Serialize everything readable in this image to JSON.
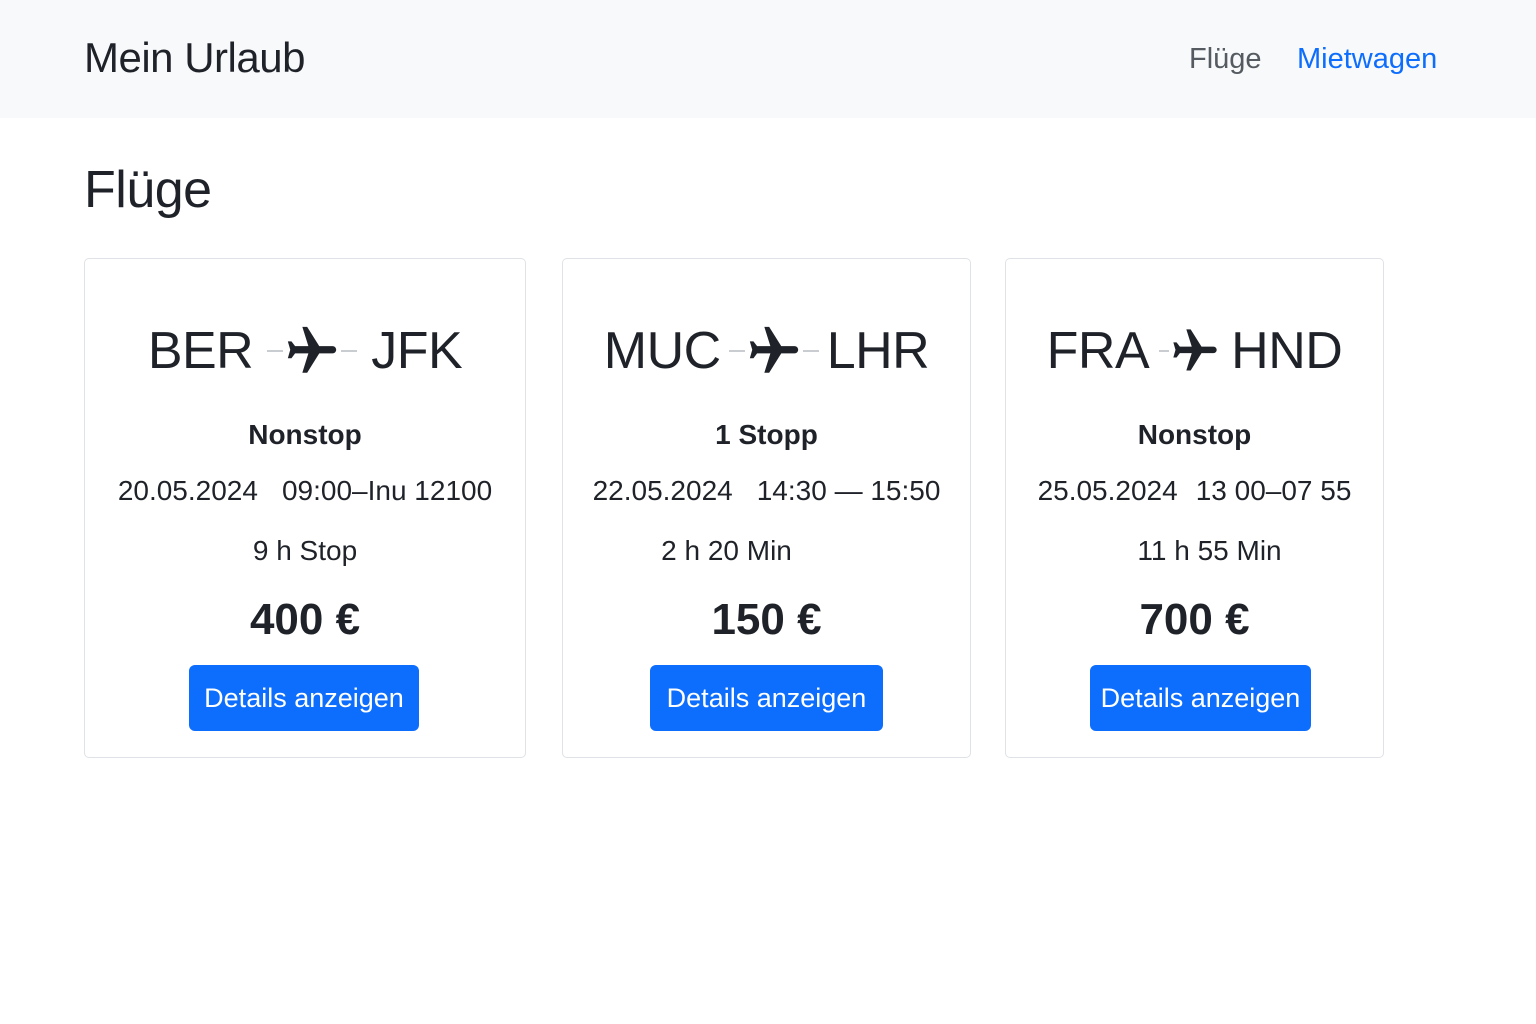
{
  "navbar": {
    "brand": "Mein Urlaub",
    "links": [
      {
        "label": "Flüge",
        "active": false
      },
      {
        "label": "Mietwagen",
        "active": true
      }
    ]
  },
  "page": {
    "title": "Flüge"
  },
  "flights": [
    {
      "from": "BER",
      "to": "JFK",
      "stops": "Nonstop",
      "date": "20.05.2024",
      "time": "09:00–Inu 12100",
      "duration": "9 h Stop",
      "price": "400 €",
      "button_label": "Details anzeigen"
    },
    {
      "from": "MUC",
      "to": "LHR",
      "stops": "1 Stopp",
      "date": "22.05.2024",
      "time": "14:30 — 15:50",
      "duration": "2 h 20 Min",
      "price": "150 €",
      "button_label": "Details anzeigen"
    },
    {
      "from": "FRA",
      "to": "HND",
      "stops": "Nonstop",
      "date": "25.05.2024",
      "time": "13 00–07 55",
      "duration": "11 h 55 Min",
      "price": "700 €",
      "button_label": "Details anzeigen"
    }
  ],
  "icons": {
    "route": "airplane-icon"
  },
  "colors": {
    "accent": "#0d6efd",
    "navbar_bg": "#f8f9fa",
    "text": "#1f2329"
  }
}
